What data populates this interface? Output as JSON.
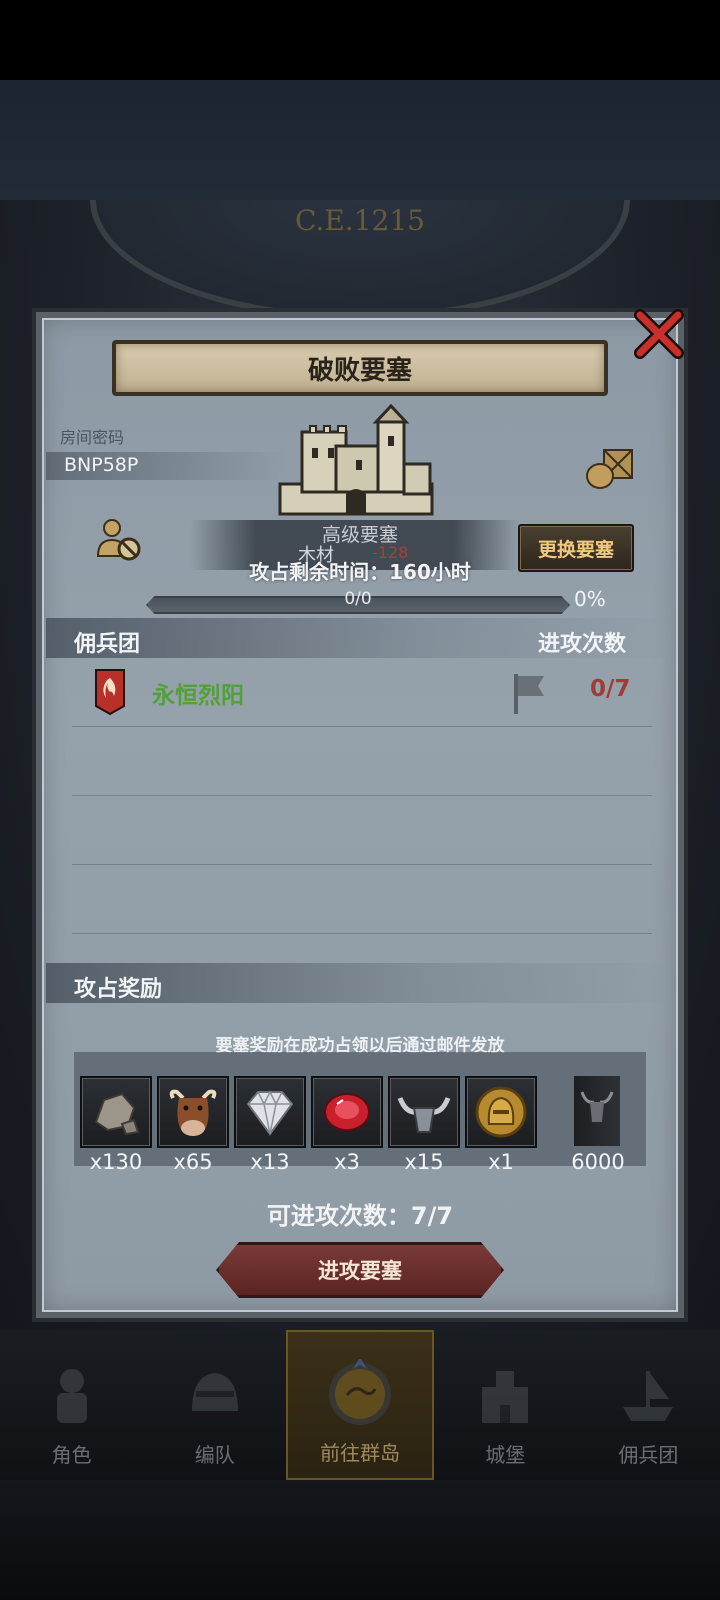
{
  "background": {
    "era_label": "C.E.1215"
  },
  "nav": {
    "items": [
      {
        "label": "角色",
        "icon": "knight-icon"
      },
      {
        "label": "编队",
        "icon": "helmet-icon"
      },
      {
        "label": "前往群岛",
        "icon": "map-compass-icon",
        "active": true
      },
      {
        "label": "城堡",
        "icon": "castle-icon"
      },
      {
        "label": "佣兵团",
        "icon": "mercenary-ship-icon"
      }
    ]
  },
  "dialog": {
    "title": "破败要塞",
    "room_label": "房间密码",
    "room_code": "BNP58P",
    "fortress_level": "高级要塞",
    "wood_label": "木材",
    "wood_value": "-128",
    "attack_time": "攻占剩余时间：160小时",
    "change_button": "更换要塞",
    "progress": {
      "current": 0,
      "total": 0,
      "text": "0/0",
      "percent_label": "0%"
    },
    "mercenary_header": "佣兵团",
    "attacks_header": "进攻次数",
    "mercenaries": [
      {
        "name": "永恒烈阳",
        "attacks": "0/7"
      }
    ],
    "reward_header": "攻占奖励",
    "reward_note": "要塞奖励在成功占领以后通过邮件发放",
    "rewards": [
      {
        "icon": "stone-icon",
        "qty": "x130"
      },
      {
        "icon": "cow-icon",
        "qty": "x65"
      },
      {
        "icon": "diamond-icon",
        "qty": "x13"
      },
      {
        "icon": "ruby-icon",
        "qty": "x3"
      },
      {
        "icon": "horned-helmet-icon",
        "qty": "x15"
      },
      {
        "icon": "gold-coin-helmet-icon",
        "qty": "x1"
      },
      {
        "icon": "bull-emblem-icon",
        "qty": "6000"
      }
    ],
    "attack_count": "可进攻次数：7/7",
    "attack_button": "进攻要塞"
  },
  "colors": {
    "merc_name": "#52a03a",
    "attack_count_red": "#a23a35",
    "change_button_text": "#f0c981",
    "attack_button_bg": "#6a2c2a"
  }
}
